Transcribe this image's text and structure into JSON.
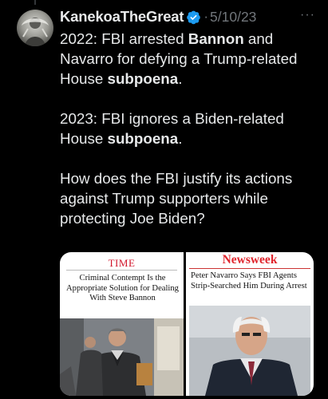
{
  "tweet": {
    "display_name": "KanekoaTheGreat",
    "date": "5/10/23",
    "separator": "·",
    "more_glyph": "···",
    "paragraph1": {
      "prefix": "2022: FBI arrested ",
      "bold1": "Bannon",
      "middle": " and Navarro for defying a Trump-related House ",
      "bold2": "subpoena",
      "suffix": "."
    },
    "paragraph2": {
      "prefix": "2023: FBI ignores a Biden-related House ",
      "bold": "subpoena",
      "suffix": "."
    },
    "paragraph3": "How does the FBI justify its actions against Trump supporters while protecting Joe Biden?"
  },
  "media": {
    "left": {
      "logo": "TIME",
      "headline": "Criminal Contempt Is the Appropriate Solution for Dealing With Steve Bannon"
    },
    "right": {
      "logo": "Newsweek",
      "headline": "Peter Navarro Says FBI Agents Strip-Searched Him During Arrest"
    }
  },
  "colors": {
    "background": "#000000",
    "text_primary": "#e7e9ea",
    "text_secondary": "#71767b",
    "verified": "#1d9bf0",
    "time_red": "#d0142a",
    "newsweek_red": "#e0262e"
  },
  "icons": {
    "verified": "verified-badge-icon",
    "more": "more-options-icon"
  }
}
